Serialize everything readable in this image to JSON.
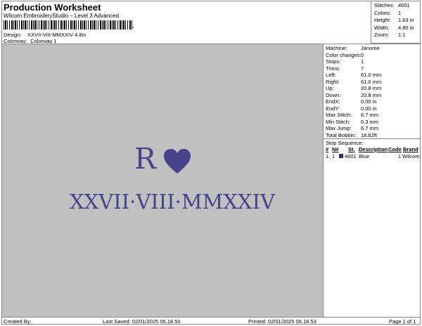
{
  "header": {
    "title": "Production Worksheet",
    "subtitle": "Wilcom EmbroideryStudio – Level 3 Advanced",
    "barcode_tail": ",",
    "design_label": "Design:",
    "design_value": "XXVII-VIII-MMXXIV 4.8in",
    "colorway_label": "Colorway:",
    "colorway_value": "Colorway 1"
  },
  "summary": [
    {
      "k": "Stitches:",
      "v": "4601"
    },
    {
      "k": "Colors:",
      "v": "1"
    },
    {
      "k": "Height:",
      "v": "1.63 in"
    },
    {
      "k": "Width:",
      "v": "4.80 in"
    },
    {
      "k": "Zoom:",
      "v": "1:1"
    }
  ],
  "design": {
    "initial": "R",
    "date_text": "XXVII·VIII·MMXXIV",
    "thread_color": "#46438a",
    "heart_icon": "heart-icon"
  },
  "details": [
    {
      "k": "Machine:",
      "v": "Janome"
    },
    {
      "k": "Color changes:",
      "v": "0"
    },
    {
      "k": "Stops:",
      "v": "1"
    },
    {
      "k": "Trims:",
      "v": "7"
    },
    {
      "k": "Left:",
      "v": "61.0 mm"
    },
    {
      "k": "Right:",
      "v": "61.0 mm"
    },
    {
      "k": "Up:",
      "v": "20.8 mm"
    },
    {
      "k": "Down:",
      "v": "20.8 mm"
    },
    {
      "k": "EndX:",
      "v": "0.00 in"
    },
    {
      "k": "EndY:",
      "v": "0.00 in"
    },
    {
      "k": "Max Stitch:",
      "v": "6.7 mm"
    },
    {
      "k": "Min Stitch:",
      "v": "0.3 mm"
    },
    {
      "k": "Max Jump:",
      "v": "6.7 mm"
    },
    {
      "k": "Total Bobbin:",
      "v": "18.62ft"
    }
  ],
  "stop_sequence": {
    "title": "Stop Sequence:",
    "headers": {
      "num": "#",
      "n": "N#",
      "st": "St.",
      "desc": "Description",
      "code": "Code",
      "brand": "Brand"
    },
    "rows": [
      {
        "num": "1.",
        "n": "1",
        "st": "4601",
        "desc": "Blue",
        "code": "1",
        "brand": "Wilcom",
        "swatch": "#2a2c7a"
      }
    ]
  },
  "footer": {
    "created": "Created By:",
    "last_saved": "Last Saved: 02/01/2025 06.18.50",
    "printed": "Printed: 02/01/2025 06.18.53",
    "page": "Page 1 of 1"
  }
}
